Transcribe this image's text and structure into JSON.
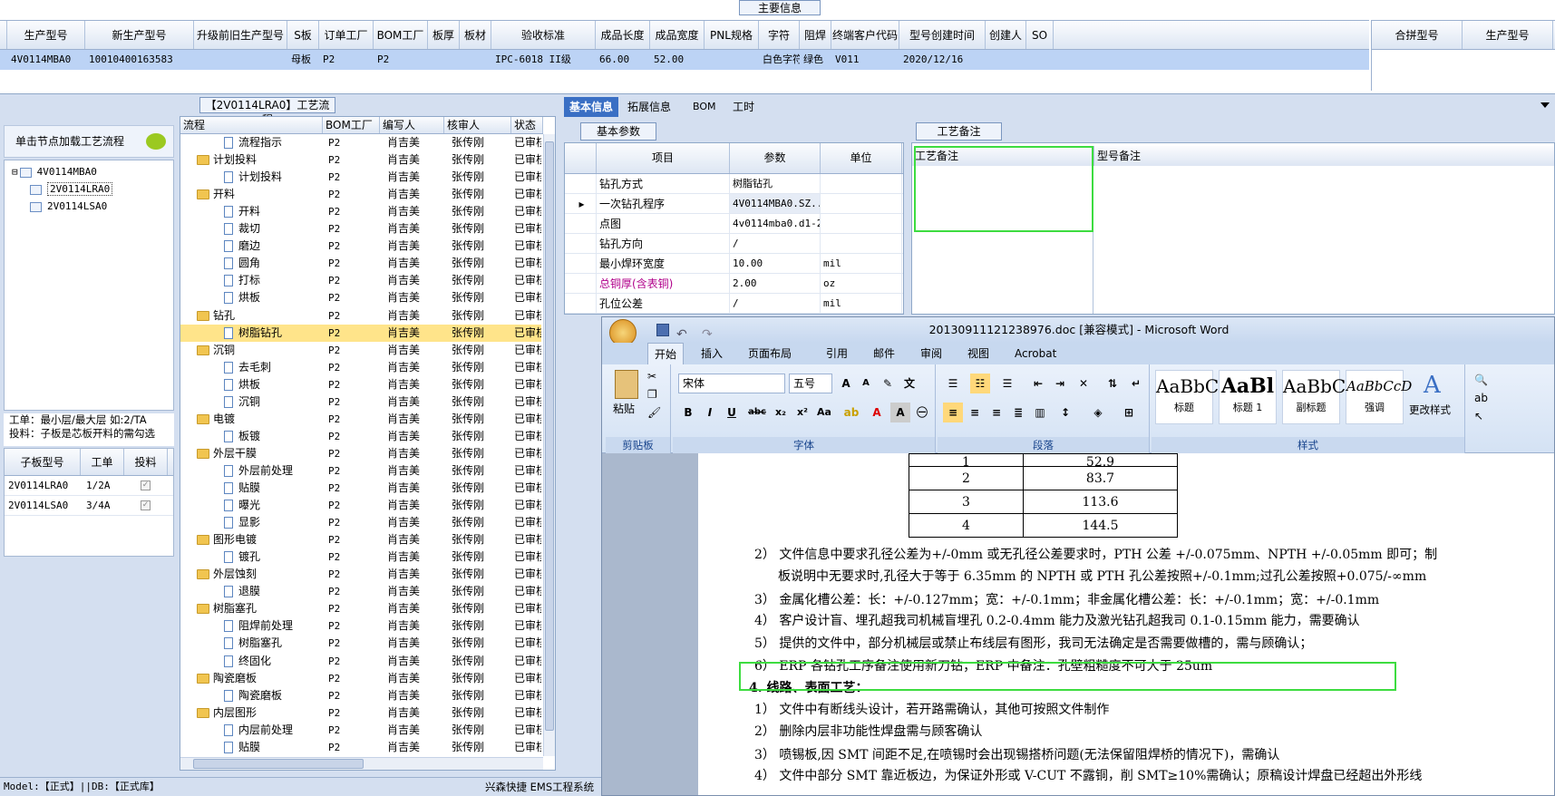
{
  "main_info": {
    "title": "主要信息",
    "columns": [
      "生产型号",
      "新生产型号",
      "升级前旧生产型号",
      "S板",
      "订单工厂",
      "BOM工厂",
      "板厚",
      "板材",
      "验收标准",
      "成品长度",
      "成品宽度",
      "PNL规格",
      "字符",
      "阻焊",
      "终端客户代码",
      "型号创建时间",
      "创建人",
      "SO"
    ],
    "row": [
      "4V0114MBA0",
      "10010400163583",
      "",
      "母板",
      "P2",
      "P2",
      "",
      "",
      "IPC-6018 II级",
      "66.00",
      "52.00",
      "",
      "白色字符",
      "绿色",
      "V011",
      "2020/12/16",
      "",
      ""
    ],
    "merge_columns": [
      "合拼型号",
      "生产型号"
    ]
  },
  "left": {
    "load_label": "单击节点加载工艺流程",
    "tree": [
      {
        "label": "4V0114MBA0",
        "level": 0
      },
      {
        "label": "2V0114LRA0",
        "level": 1
      },
      {
        "label": "2V0114LSA0",
        "level": 1
      }
    ],
    "hint_line1": "工单：最小层/最大层 如:2/TA",
    "hint_line2": "投料：子板是芯板开料的需勾选",
    "sub_columns": [
      "子板型号",
      "工单",
      "投料"
    ],
    "sub_rows": [
      {
        "model": "2V0114LRA0",
        "order": "1/2A"
      },
      {
        "model": "2V0114LSA0",
        "order": "3/4A"
      }
    ]
  },
  "process": {
    "title": "【2V0114LRA0】工艺流程",
    "columns": [
      "流程",
      "BOM工厂",
      "编写人",
      "核审人",
      "状态"
    ],
    "rows": [
      {
        "name": "流程指示",
        "type": "doc",
        "bom": "P2",
        "writer": "肖吉美",
        "checker": "张传刚",
        "status": "已审核"
      },
      {
        "name": "计划投料",
        "type": "folder",
        "bom": "P2",
        "writer": "肖吉美",
        "checker": "张传刚",
        "status": "已审核"
      },
      {
        "name": "计划投料",
        "type": "doc",
        "bom": "P2",
        "writer": "肖吉美",
        "checker": "张传刚",
        "status": "已审核"
      },
      {
        "name": "开料",
        "type": "folder",
        "bom": "P2",
        "writer": "肖吉美",
        "checker": "张传刚",
        "status": "已审核"
      },
      {
        "name": "开料",
        "type": "doc",
        "bom": "P2",
        "writer": "肖吉美",
        "checker": "张传刚",
        "status": "已审核"
      },
      {
        "name": "裁切",
        "type": "doc",
        "bom": "P2",
        "writer": "肖吉美",
        "checker": "张传刚",
        "status": "已审核"
      },
      {
        "name": "磨边",
        "type": "doc",
        "bom": "P2",
        "writer": "肖吉美",
        "checker": "张传刚",
        "status": "已审核"
      },
      {
        "name": "圆角",
        "type": "doc",
        "bom": "P2",
        "writer": "肖吉美",
        "checker": "张传刚",
        "status": "已审核"
      },
      {
        "name": "打标",
        "type": "doc",
        "bom": "P2",
        "writer": "肖吉美",
        "checker": "张传刚",
        "status": "已审核"
      },
      {
        "name": "烘板",
        "type": "doc",
        "bom": "P2",
        "writer": "肖吉美",
        "checker": "张传刚",
        "status": "已审核"
      },
      {
        "name": "钻孔",
        "type": "folder",
        "bom": "P2",
        "writer": "肖吉美",
        "checker": "张传刚",
        "status": "已审核"
      },
      {
        "name": "树脂钻孔",
        "type": "doc",
        "bom": "P2",
        "writer": "肖吉美",
        "checker": "张传刚",
        "status": "已审核",
        "selected": true
      },
      {
        "name": "沉铜",
        "type": "folder",
        "bom": "P2",
        "writer": "肖吉美",
        "checker": "张传刚",
        "status": "已审核"
      },
      {
        "name": "去毛刺",
        "type": "doc",
        "bom": "P2",
        "writer": "肖吉美",
        "checker": "张传刚",
        "status": "已审核"
      },
      {
        "name": "烘板",
        "type": "doc",
        "bom": "P2",
        "writer": "肖吉美",
        "checker": "张传刚",
        "status": "已审核"
      },
      {
        "name": "沉铜",
        "type": "doc",
        "bom": "P2",
        "writer": "肖吉美",
        "checker": "张传刚",
        "status": "已审核"
      },
      {
        "name": "电镀",
        "type": "folder",
        "bom": "P2",
        "writer": "肖吉美",
        "checker": "张传刚",
        "status": "已审核"
      },
      {
        "name": "板镀",
        "type": "doc",
        "bom": "P2",
        "writer": "肖吉美",
        "checker": "张传刚",
        "status": "已审核"
      },
      {
        "name": "外层干膜",
        "type": "folder",
        "bom": "P2",
        "writer": "肖吉美",
        "checker": "张传刚",
        "status": "已审核"
      },
      {
        "name": "外层前处理",
        "type": "doc",
        "bom": "P2",
        "writer": "肖吉美",
        "checker": "张传刚",
        "status": "已审核"
      },
      {
        "name": "贴膜",
        "type": "doc",
        "bom": "P2",
        "writer": "肖吉美",
        "checker": "张传刚",
        "status": "已审核"
      },
      {
        "name": "曝光",
        "type": "doc",
        "bom": "P2",
        "writer": "肖吉美",
        "checker": "张传刚",
        "status": "已审核"
      },
      {
        "name": "显影",
        "type": "doc",
        "bom": "P2",
        "writer": "肖吉美",
        "checker": "张传刚",
        "status": "已审核"
      },
      {
        "name": "图形电镀",
        "type": "folder",
        "bom": "P2",
        "writer": "肖吉美",
        "checker": "张传刚",
        "status": "已审核"
      },
      {
        "name": "镀孔",
        "type": "doc",
        "bom": "P2",
        "writer": "肖吉美",
        "checker": "张传刚",
        "status": "已审核"
      },
      {
        "name": "外层蚀刻",
        "type": "folder",
        "bom": "P2",
        "writer": "肖吉美",
        "checker": "张传刚",
        "status": "已审核"
      },
      {
        "name": "退膜",
        "type": "doc",
        "bom": "P2",
        "writer": "肖吉美",
        "checker": "张传刚",
        "status": "已审核"
      },
      {
        "name": "树脂塞孔",
        "type": "folder",
        "bom": "P2",
        "writer": "肖吉美",
        "checker": "张传刚",
        "status": "已审核"
      },
      {
        "name": "阻焊前处理",
        "type": "doc",
        "bom": "P2",
        "writer": "肖吉美",
        "checker": "张传刚",
        "status": "已审核"
      },
      {
        "name": "树脂塞孔",
        "type": "doc",
        "bom": "P2",
        "writer": "肖吉美",
        "checker": "张传刚",
        "status": "已审核"
      },
      {
        "name": "终固化",
        "type": "doc",
        "bom": "P2",
        "writer": "肖吉美",
        "checker": "张传刚",
        "status": "已审核"
      },
      {
        "name": "陶瓷磨板",
        "type": "folder",
        "bom": "P2",
        "writer": "肖吉美",
        "checker": "张传刚",
        "status": "已审核"
      },
      {
        "name": "陶瓷磨板",
        "type": "doc",
        "bom": "P2",
        "writer": "肖吉美",
        "checker": "张传刚",
        "status": "已审核"
      },
      {
        "name": "内层图形",
        "type": "folder",
        "bom": "P2",
        "writer": "肖吉美",
        "checker": "张传刚",
        "status": "已审核"
      },
      {
        "name": "内层前处理",
        "type": "doc",
        "bom": "P2",
        "writer": "肖吉美",
        "checker": "张传刚",
        "status": "已审核"
      },
      {
        "name": "贴膜",
        "type": "doc",
        "bom": "P2",
        "writer": "肖吉美",
        "checker": "张传刚",
        "status": "已审核"
      }
    ]
  },
  "tabs": [
    "基本信息",
    "拓展信息",
    "BOM",
    "工时"
  ],
  "basic": {
    "title": "基本参数",
    "columns": [
      "项目",
      "参数",
      "单位"
    ],
    "rows": [
      {
        "item": "钻孔方式",
        "value": "树脂钻孔",
        "unit": ""
      },
      {
        "item": "一次钻孔程序",
        "value": "4V0114MBA0.SZ...",
        "unit": ""
      },
      {
        "item": "点图",
        "value": "4v0114mba0.d1-2",
        "unit": ""
      },
      {
        "item": "钻孔方向",
        "value": "/",
        "unit": ""
      },
      {
        "item": "最小焊环宽度",
        "value": "10.00",
        "unit": "mil"
      },
      {
        "item": "总铜厚(含表铜)",
        "value": "2.00",
        "unit": "oz"
      },
      {
        "item": "孔位公差",
        "value": "/",
        "unit": "mil"
      }
    ]
  },
  "remark": {
    "title": "工艺备注",
    "col1": "工艺备注",
    "col2": "型号备注"
  },
  "word": {
    "title": "20130911121238976.doc [兼容模式] - Microsoft Word",
    "tabs": [
      "开始",
      "插入",
      "页面布局",
      "引用",
      "邮件",
      "审阅",
      "视图",
      "Acrobat"
    ],
    "font_name": "宋体",
    "font_size": "五号",
    "groups": [
      "剪贴板",
      "字体",
      "段落",
      "样式"
    ],
    "paste": "粘贴",
    "styles": [
      {
        "sample": "AaBbC",
        "label": "标题"
      },
      {
        "sample": "AaBl",
        "label": "标题 1"
      },
      {
        "sample": "AaBbC",
        "label": "副标题"
      },
      {
        "sample": "AaBbCcD",
        "label": "强调"
      }
    ],
    "change_style": "更改样式",
    "table": [
      [
        "1",
        "52.9"
      ],
      [
        "2",
        "83.7"
      ],
      [
        "3",
        "113.6"
      ],
      [
        "4",
        "144.5"
      ]
    ],
    "lines": [
      "2） 文件信息中要求孔径公差为+/-0mm 或无孔径公差要求时，PTH 公差 +/-0.075mm、NPTH +/-0.05mm 即可；制",
      "板说明中无要求时,孔径大于等于 6.35mm 的 NPTH 或 PTH 孔公差按照+/-0.1mm;过孔公差按照+0.075/-∞mm",
      "3） 金属化槽公差：长：+/-0.127mm；宽：+/-0.1mm；非金属化槽公差：长：+/-0.1mm；宽：+/-0.1mm",
      "4） 客户设计盲、埋孔超我司机械盲埋孔 0.2-0.4mm 能力及激光钻孔超我司 0.1-0.15mm 能力，需要确认",
      "5） 提供的文件中，部分机械层或禁止布线层有图形，我司无法确定是否需要做槽的，需与顾确认；",
      "6） ERP 各钻孔工序备注使用新刀钻；ERP 中备注：孔壁粗糙度不可大于 25um",
      "4.  线路、表面工艺：",
      "1） 文件中有断线头设计，若开路需确认，其他可按照文件制作",
      "2） 删除内层非功能性焊盘需与顾客确认",
      "3） 喷锡板,因 SMT 间距不足,在喷锡时会出现锡搭桥问题(无法保留阻焊桥的情况下)，需确认",
      "4） 文件中部分 SMT 靠近板边，为保证外形或 V-CUT 不露铜，削 SMT≥10%需确认；原稿设计焊盘已经超出外形线"
    ]
  },
  "status": {
    "left": "Model:【正式】||DB:【正式库】",
    "right": "兴森快捷 EMS工程系统"
  }
}
